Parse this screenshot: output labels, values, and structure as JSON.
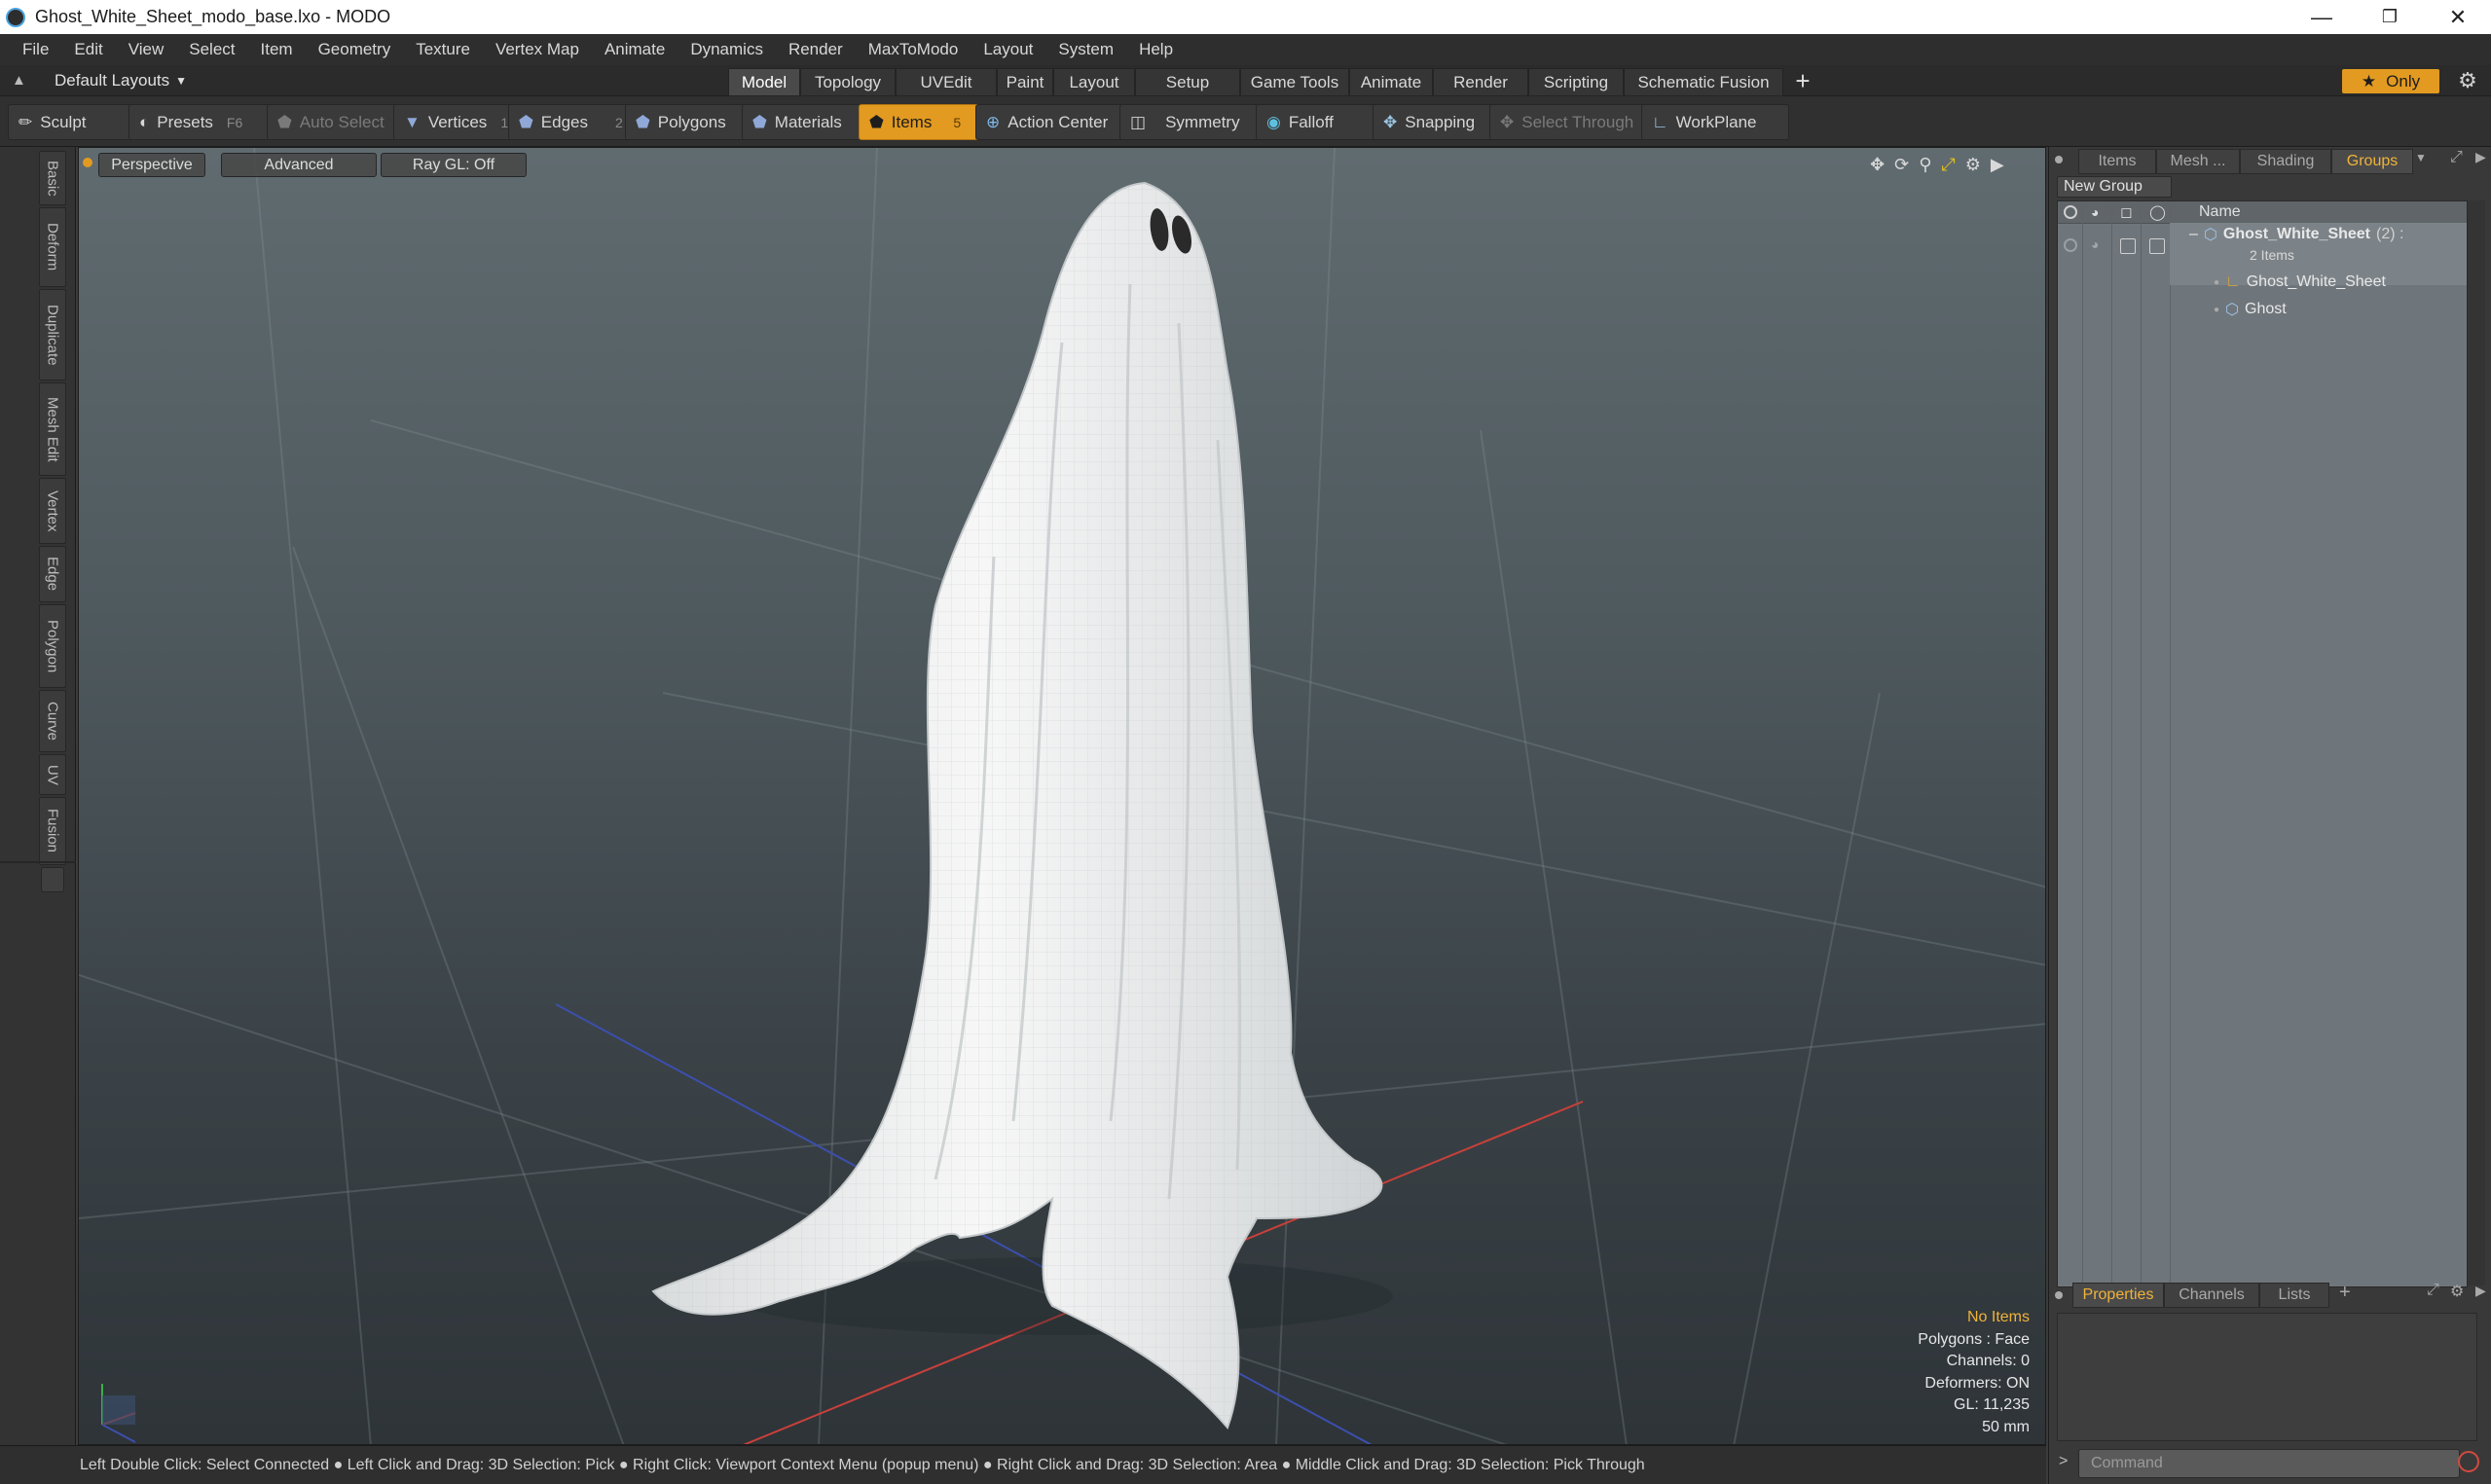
{
  "window": {
    "title": "Ghost_White_Sheet_modo_base.lxo - MODO",
    "controls": [
      "minimize-icon",
      "restore-icon",
      "close-icon"
    ]
  },
  "menu": [
    "File",
    "Edit",
    "View",
    "Select",
    "Item",
    "Geometry",
    "Texture",
    "Vertex Map",
    "Animate",
    "Dynamics",
    "Render",
    "MaxToModo",
    "Layout",
    "System",
    "Help"
  ],
  "layout_bar": {
    "layouts_label": "Default Layouts",
    "tabs": [
      "Model",
      "Topology",
      "UVEdit",
      "Paint",
      "Layout",
      "Setup",
      "Game Tools",
      "Animate",
      "Render",
      "Scripting",
      "Schematic Fusion"
    ],
    "active_tab": "Model",
    "add_tab": "+",
    "only_label": "Only"
  },
  "toolbar": {
    "sculpt": "Sculpt",
    "presets": "Presets",
    "presets_key": "F6",
    "auto_select": "Auto Select",
    "vertices": "Vertices",
    "vertices_key": "1",
    "edges": "Edges",
    "edges_key": "2",
    "polygons": "Polygons",
    "materials": "Materials",
    "items": "Items",
    "items_key": "5",
    "action_center": "Action Center",
    "symmetry": "Symmetry",
    "falloff": "Falloff",
    "snapping": "Snapping",
    "select_through": "Select Through",
    "workplane": "WorkPlane"
  },
  "left_tabs": [
    "Basic",
    "Deform",
    "Duplicate",
    "Mesh Edit",
    "Vertex",
    "Edge",
    "Polygon",
    "Curve",
    "UV",
    "Fusion"
  ],
  "viewport": {
    "view_mode": "Perspective",
    "shading": "Advanced",
    "raygl": "Ray GL: Off",
    "info": {
      "no_items": "No Items",
      "polygons": "Polygons : Face",
      "channels": "Channels: 0",
      "deformers": "Deformers: ON",
      "gl": "GL: 11,235",
      "scale": "50 mm"
    }
  },
  "status_bar": "Left Double Click: Select Connected ● Left Click and Drag: 3D Selection: Pick ● Right Click: Viewport Context Menu (popup menu) ● Right Click and Drag: 3D Selection: Area ● Middle Click and Drag: 3D Selection: Pick Through",
  "right_panel": {
    "tabs": [
      "Items",
      "Mesh ...",
      "Shading",
      "Groups"
    ],
    "active_tab": "Groups",
    "new_group": "New Group",
    "name_header": "Name",
    "group_name": "Ghost_White_Sheet",
    "group_count": "(2) :",
    "group_subtitle": "2 Items",
    "children": [
      "Ghost_White_Sheet",
      "Ghost"
    ],
    "bottom_tabs": [
      "Properties",
      "Channels",
      "Lists"
    ],
    "bottom_active": "Properties",
    "bottom_add": "+",
    "command_placeholder": "Command"
  },
  "colors": {
    "accent": "#e29a20",
    "highlight_text": "#f0b33a",
    "axis_red": "#c8403a",
    "axis_blue": "#3c4fae",
    "axis_green": "#3fae4a"
  }
}
